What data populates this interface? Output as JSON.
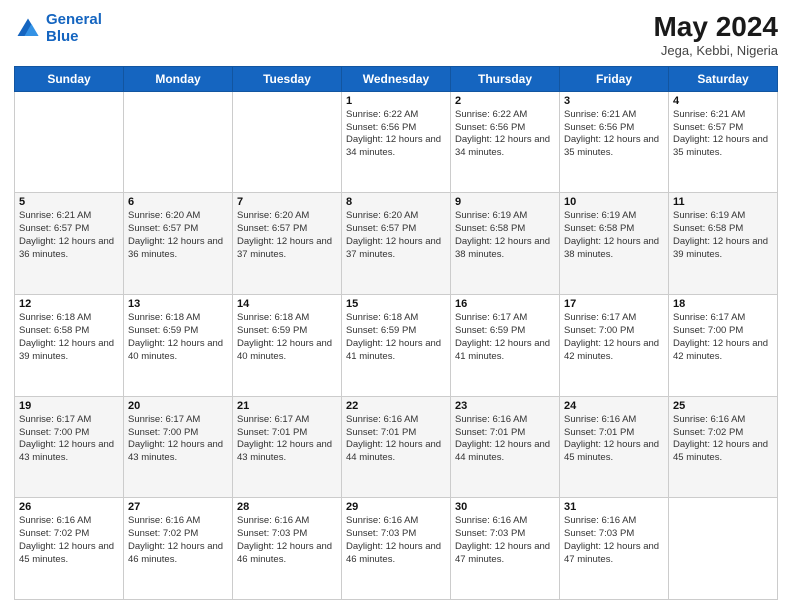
{
  "header": {
    "logo_line1": "General",
    "logo_line2": "Blue",
    "month": "May 2024",
    "location": "Jega, Kebbi, Nigeria"
  },
  "weekdays": [
    "Sunday",
    "Monday",
    "Tuesday",
    "Wednesday",
    "Thursday",
    "Friday",
    "Saturday"
  ],
  "weeks": [
    [
      {
        "day": "",
        "sunrise": "",
        "sunset": "",
        "daylight": ""
      },
      {
        "day": "",
        "sunrise": "",
        "sunset": "",
        "daylight": ""
      },
      {
        "day": "",
        "sunrise": "",
        "sunset": "",
        "daylight": ""
      },
      {
        "day": "1",
        "sunrise": "Sunrise: 6:22 AM",
        "sunset": "Sunset: 6:56 PM",
        "daylight": "Daylight: 12 hours and 34 minutes."
      },
      {
        "day": "2",
        "sunrise": "Sunrise: 6:22 AM",
        "sunset": "Sunset: 6:56 PM",
        "daylight": "Daylight: 12 hours and 34 minutes."
      },
      {
        "day": "3",
        "sunrise": "Sunrise: 6:21 AM",
        "sunset": "Sunset: 6:56 PM",
        "daylight": "Daylight: 12 hours and 35 minutes."
      },
      {
        "day": "4",
        "sunrise": "Sunrise: 6:21 AM",
        "sunset": "Sunset: 6:57 PM",
        "daylight": "Daylight: 12 hours and 35 minutes."
      }
    ],
    [
      {
        "day": "5",
        "sunrise": "Sunrise: 6:21 AM",
        "sunset": "Sunset: 6:57 PM",
        "daylight": "Daylight: 12 hours and 36 minutes."
      },
      {
        "day": "6",
        "sunrise": "Sunrise: 6:20 AM",
        "sunset": "Sunset: 6:57 PM",
        "daylight": "Daylight: 12 hours and 36 minutes."
      },
      {
        "day": "7",
        "sunrise": "Sunrise: 6:20 AM",
        "sunset": "Sunset: 6:57 PM",
        "daylight": "Daylight: 12 hours and 37 minutes."
      },
      {
        "day": "8",
        "sunrise": "Sunrise: 6:20 AM",
        "sunset": "Sunset: 6:57 PM",
        "daylight": "Daylight: 12 hours and 37 minutes."
      },
      {
        "day": "9",
        "sunrise": "Sunrise: 6:19 AM",
        "sunset": "Sunset: 6:58 PM",
        "daylight": "Daylight: 12 hours and 38 minutes."
      },
      {
        "day": "10",
        "sunrise": "Sunrise: 6:19 AM",
        "sunset": "Sunset: 6:58 PM",
        "daylight": "Daylight: 12 hours and 38 minutes."
      },
      {
        "day": "11",
        "sunrise": "Sunrise: 6:19 AM",
        "sunset": "Sunset: 6:58 PM",
        "daylight": "Daylight: 12 hours and 39 minutes."
      }
    ],
    [
      {
        "day": "12",
        "sunrise": "Sunrise: 6:18 AM",
        "sunset": "Sunset: 6:58 PM",
        "daylight": "Daylight: 12 hours and 39 minutes."
      },
      {
        "day": "13",
        "sunrise": "Sunrise: 6:18 AM",
        "sunset": "Sunset: 6:59 PM",
        "daylight": "Daylight: 12 hours and 40 minutes."
      },
      {
        "day": "14",
        "sunrise": "Sunrise: 6:18 AM",
        "sunset": "Sunset: 6:59 PM",
        "daylight": "Daylight: 12 hours and 40 minutes."
      },
      {
        "day": "15",
        "sunrise": "Sunrise: 6:18 AM",
        "sunset": "Sunset: 6:59 PM",
        "daylight": "Daylight: 12 hours and 41 minutes."
      },
      {
        "day": "16",
        "sunrise": "Sunrise: 6:17 AM",
        "sunset": "Sunset: 6:59 PM",
        "daylight": "Daylight: 12 hours and 41 minutes."
      },
      {
        "day": "17",
        "sunrise": "Sunrise: 6:17 AM",
        "sunset": "Sunset: 7:00 PM",
        "daylight": "Daylight: 12 hours and 42 minutes."
      },
      {
        "day": "18",
        "sunrise": "Sunrise: 6:17 AM",
        "sunset": "Sunset: 7:00 PM",
        "daylight": "Daylight: 12 hours and 42 minutes."
      }
    ],
    [
      {
        "day": "19",
        "sunrise": "Sunrise: 6:17 AM",
        "sunset": "Sunset: 7:00 PM",
        "daylight": "Daylight: 12 hours and 43 minutes."
      },
      {
        "day": "20",
        "sunrise": "Sunrise: 6:17 AM",
        "sunset": "Sunset: 7:00 PM",
        "daylight": "Daylight: 12 hours and 43 minutes."
      },
      {
        "day": "21",
        "sunrise": "Sunrise: 6:17 AM",
        "sunset": "Sunset: 7:01 PM",
        "daylight": "Daylight: 12 hours and 43 minutes."
      },
      {
        "day": "22",
        "sunrise": "Sunrise: 6:16 AM",
        "sunset": "Sunset: 7:01 PM",
        "daylight": "Daylight: 12 hours and 44 minutes."
      },
      {
        "day": "23",
        "sunrise": "Sunrise: 6:16 AM",
        "sunset": "Sunset: 7:01 PM",
        "daylight": "Daylight: 12 hours and 44 minutes."
      },
      {
        "day": "24",
        "sunrise": "Sunrise: 6:16 AM",
        "sunset": "Sunset: 7:01 PM",
        "daylight": "Daylight: 12 hours and 45 minutes."
      },
      {
        "day": "25",
        "sunrise": "Sunrise: 6:16 AM",
        "sunset": "Sunset: 7:02 PM",
        "daylight": "Daylight: 12 hours and 45 minutes."
      }
    ],
    [
      {
        "day": "26",
        "sunrise": "Sunrise: 6:16 AM",
        "sunset": "Sunset: 7:02 PM",
        "daylight": "Daylight: 12 hours and 45 minutes."
      },
      {
        "day": "27",
        "sunrise": "Sunrise: 6:16 AM",
        "sunset": "Sunset: 7:02 PM",
        "daylight": "Daylight: 12 hours and 46 minutes."
      },
      {
        "day": "28",
        "sunrise": "Sunrise: 6:16 AM",
        "sunset": "Sunset: 7:03 PM",
        "daylight": "Daylight: 12 hours and 46 minutes."
      },
      {
        "day": "29",
        "sunrise": "Sunrise: 6:16 AM",
        "sunset": "Sunset: 7:03 PM",
        "daylight": "Daylight: 12 hours and 46 minutes."
      },
      {
        "day": "30",
        "sunrise": "Sunrise: 6:16 AM",
        "sunset": "Sunset: 7:03 PM",
        "daylight": "Daylight: 12 hours and 47 minutes."
      },
      {
        "day": "31",
        "sunrise": "Sunrise: 6:16 AM",
        "sunset": "Sunset: 7:03 PM",
        "daylight": "Daylight: 12 hours and 47 minutes."
      },
      {
        "day": "",
        "sunrise": "",
        "sunset": "",
        "daylight": ""
      }
    ]
  ]
}
